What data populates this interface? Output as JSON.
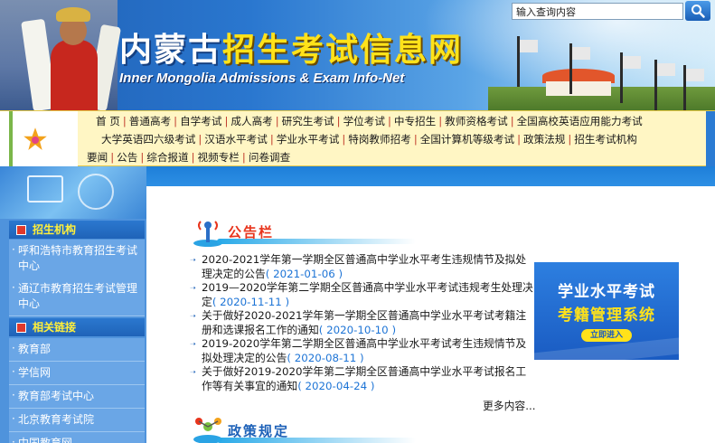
{
  "header": {
    "title_white": "内蒙古",
    "title_yellow": "招生考试信息网",
    "subtitle_en": "Inner Mongolia Admissions &  Exam Info-Net",
    "search_placeholder": "输入查询内容"
  },
  "nav": {
    "row1": [
      "首 页",
      "普通高考",
      "自学考试",
      "成人高考",
      "研究生考试",
      "学位考试",
      "中专招生",
      "教师资格考试",
      "全国高校英语应用能力考试"
    ],
    "row2": [
      "大学英语四六级考试",
      "汉语水平考试",
      "学业水平考试",
      "特岗教师招考",
      "全国计算机等级考试",
      "政策法规",
      "招生考试机构"
    ],
    "row3": [
      "要闻",
      "公告",
      "综合报道",
      "视频专栏",
      "问卷调查"
    ]
  },
  "sidebar": {
    "section1_title": "招生机构",
    "section1_items": [
      "呼和浩特市教育招生考试中心",
      "通辽市教育招生考试管理中心"
    ],
    "section2_title": "相关链接",
    "section2_items": [
      "教育部",
      "学信网",
      "教育部考试中心",
      "北京教育考试院",
      "中国教育网"
    ]
  },
  "notices": {
    "title": "公告栏",
    "items": [
      {
        "text": "2020-2021学年第一学期全区普通高中学业水平考生违规情节及拟处理决定的公告",
        "date": "( 2021-01-06 )"
      },
      {
        "text": "2019—2020学年第二学期全区普通高中学业水平考试违规考生处理决定",
        "date": "( 2020-11-11 )"
      },
      {
        "text": "关于做好2020-2021学年第一学期全区普通高中学业水平考试考籍注册和选课报名工作的通知",
        "date": "( 2020-10-10 )"
      },
      {
        "text": "2019-2020学年第二学期全区普通高中学业水平考试考生违规情节及拟处理决定的公告",
        "date": "( 2020-08-11 )"
      },
      {
        "text": "关于做好2019-2020学年第二学期全区普通高中学业水平考试报名工作等有关事宜的通知",
        "date": "( 2020-04-24 )"
      }
    ],
    "more": "更多内容..."
  },
  "promo": {
    "line1": "学业水平考试",
    "line2": "考籍管理系统",
    "button": "立即进入"
  },
  "policy": {
    "title": "政策规定"
  },
  "colors": {
    "accent_red": "#e8341c",
    "nav_bg": "#fff6c4",
    "sidebar_blue": "#4f93dc",
    "date_blue": "#1d74d6"
  }
}
